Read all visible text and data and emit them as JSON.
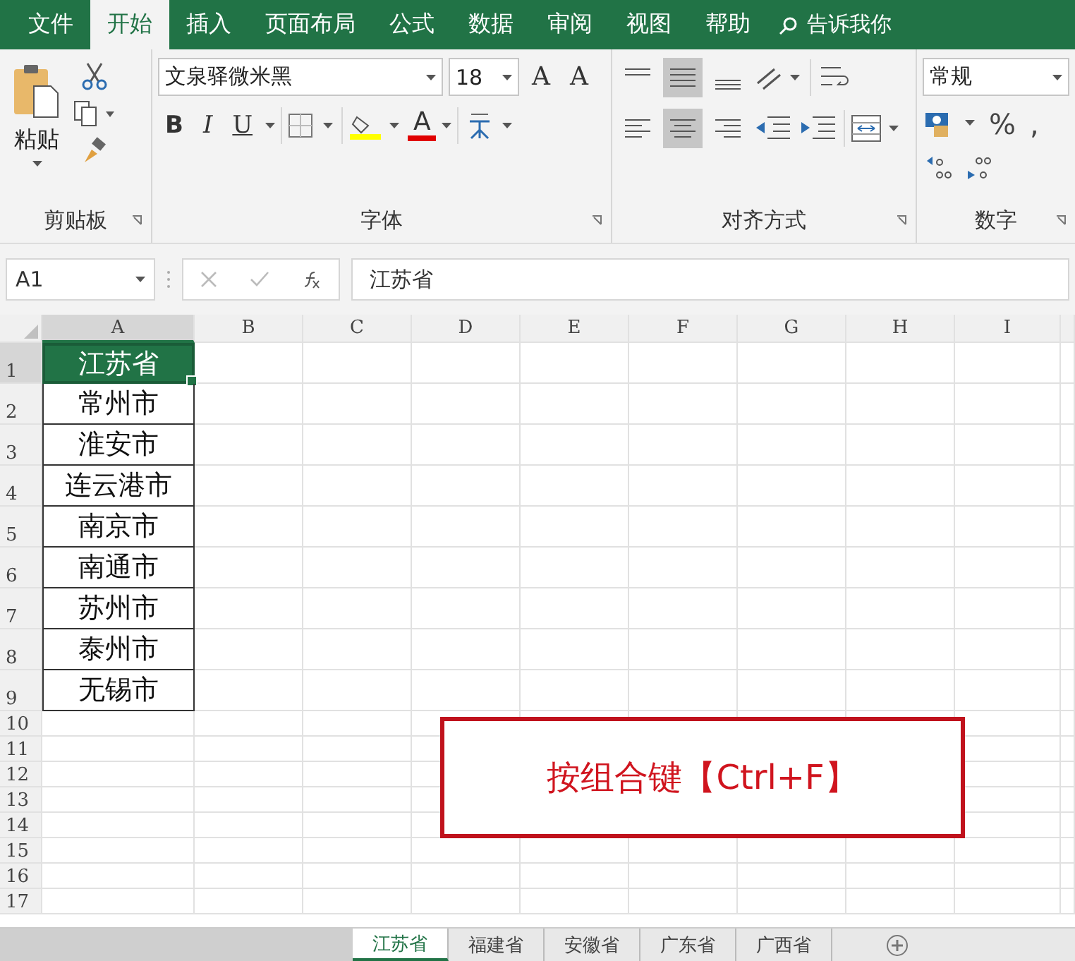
{
  "ribbon_tabs": [
    {
      "label": "文件",
      "selected": false
    },
    {
      "label": "开始",
      "selected": true
    },
    {
      "label": "插入",
      "selected": false
    },
    {
      "label": "页面布局",
      "selected": false
    },
    {
      "label": "公式",
      "selected": false
    },
    {
      "label": "数据",
      "selected": false
    },
    {
      "label": "审阅",
      "selected": false
    },
    {
      "label": "视图",
      "selected": false
    },
    {
      "label": "帮助",
      "selected": false
    }
  ],
  "tell_me": "告诉我你",
  "ribbon": {
    "paste_label": "粘贴",
    "font_name": "文泉驿微米黑",
    "font_size": "18",
    "grow_font": "A",
    "shrink_font": "A",
    "bold": "B",
    "italic": "I",
    "underline": "U",
    "font_color": "A",
    "number_format": "常规",
    "percent": "%",
    "comma": ",",
    "groups": [
      "剪贴板",
      "字体",
      "对齐方式",
      "数字"
    ]
  },
  "formula_bar": {
    "name_box": "A1",
    "formula": "江苏省"
  },
  "columns": [
    "A",
    "B",
    "C",
    "D",
    "E",
    "F",
    "G",
    "H",
    "I"
  ],
  "rows": [
    {
      "number": "1",
      "cell": "江苏省",
      "selected": true
    },
    {
      "number": "2",
      "cell": "常州市",
      "selected": false
    },
    {
      "number": "3",
      "cell": "淮安市",
      "selected": false
    },
    {
      "number": "4",
      "cell": "连云港市",
      "selected": false
    },
    {
      "number": "5",
      "cell": "南京市",
      "selected": false
    },
    {
      "number": "6",
      "cell": "南通市",
      "selected": false
    },
    {
      "number": "7",
      "cell": "苏州市",
      "selected": false
    },
    {
      "number": "8",
      "cell": "泰州市",
      "selected": false
    },
    {
      "number": "9",
      "cell": "无锡市",
      "selected": false
    },
    {
      "number": "10"
    },
    {
      "number": "11"
    },
    {
      "number": "12"
    },
    {
      "number": "13"
    },
    {
      "number": "14"
    },
    {
      "number": "15"
    },
    {
      "number": "16"
    },
    {
      "number": "17"
    }
  ],
  "annotation": "按组合键【Ctrl+F】",
  "sheet_tabs": [
    {
      "label": "江苏省",
      "selected": true
    },
    {
      "label": "福建省",
      "selected": false
    },
    {
      "label": "安徽省",
      "selected": false
    },
    {
      "label": "广东省",
      "selected": false
    },
    {
      "label": "广西省",
      "selected": false
    }
  ]
}
